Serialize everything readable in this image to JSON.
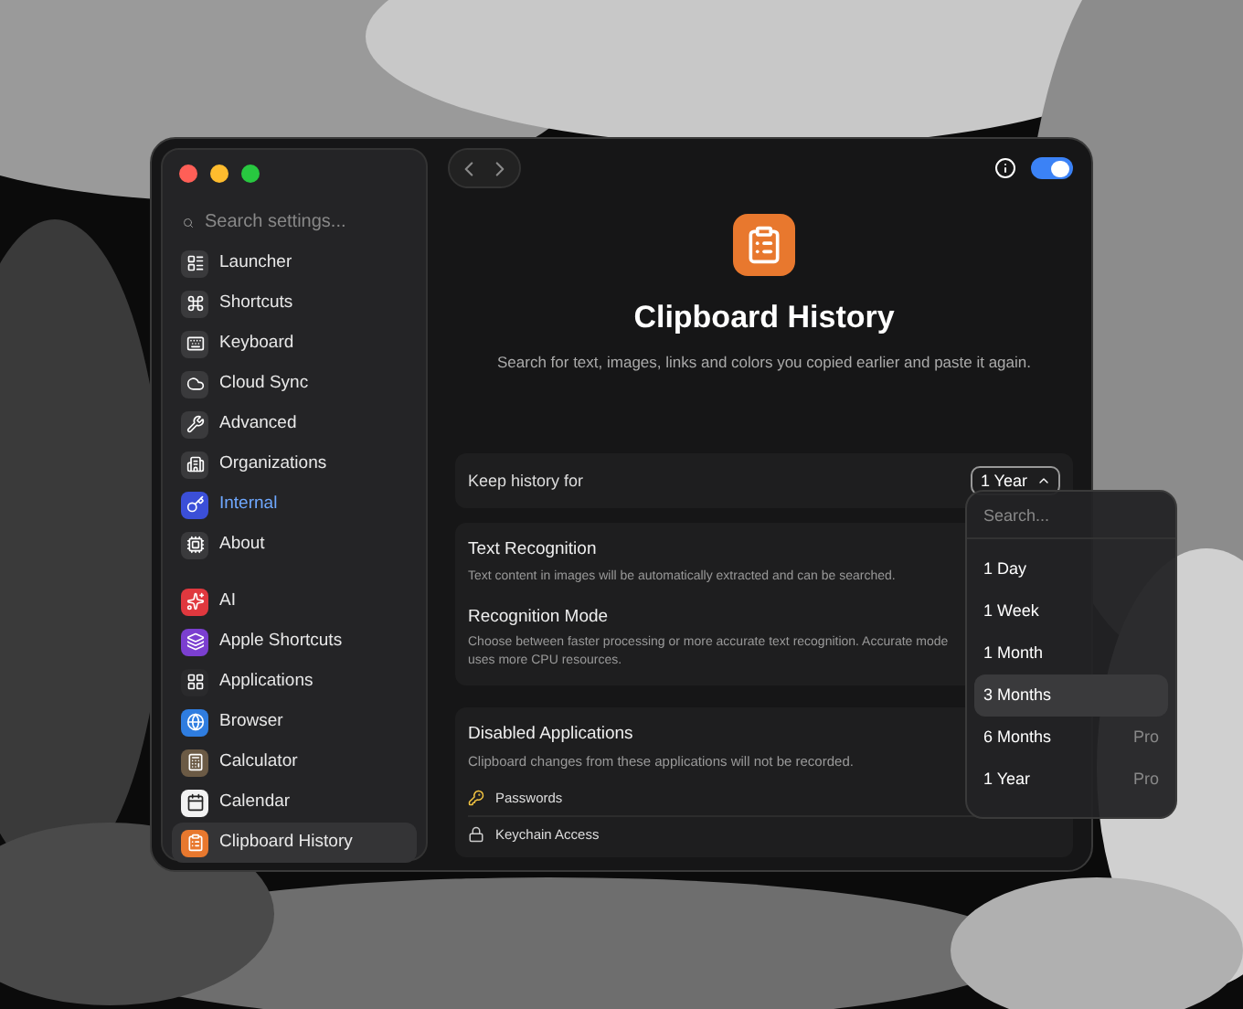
{
  "sidebar": {
    "search": {
      "placeholder": "Search settings..."
    },
    "groups": [
      [
        {
          "label": "Launcher",
          "color": "#3a3a3c",
          "selected": false,
          "kind": "normal"
        },
        {
          "label": "Shortcuts",
          "color": "#3a3a3c",
          "selected": false,
          "kind": "normal"
        },
        {
          "label": "Keyboard",
          "color": "#3a3a3c",
          "selected": false,
          "kind": "normal"
        },
        {
          "label": "Cloud Sync",
          "color": "#3a3a3c",
          "selected": false,
          "kind": "normal"
        },
        {
          "label": "Advanced",
          "color": "#3a3a3c",
          "selected": false,
          "kind": "normal"
        },
        {
          "label": "Organizations",
          "color": "#3a3a3c",
          "selected": false,
          "kind": "normal"
        },
        {
          "label": "Internal",
          "color": "#3b4fd8",
          "selected": false,
          "kind": "accent"
        },
        {
          "label": "About",
          "color": "#3a3a3c",
          "selected": false,
          "kind": "normal"
        }
      ],
      [
        {
          "label": "AI",
          "color": "#e0383e",
          "selected": false,
          "kind": "normal"
        },
        {
          "label": "Apple Shortcuts",
          "color": "#7b3fd0",
          "selected": false,
          "kind": "normal"
        },
        {
          "label": "Applications",
          "color": "#2a2a2c",
          "selected": false,
          "kind": "normal"
        },
        {
          "label": "Browser",
          "color": "#2f7de0",
          "selected": false,
          "kind": "normal"
        },
        {
          "label": "Calculator",
          "color": "#6b5a45",
          "selected": false,
          "kind": "normal"
        },
        {
          "label": "Calendar",
          "color": "#f2f2f2",
          "selected": false,
          "kind": "normal"
        },
        {
          "label": "Clipboard History",
          "color": "#e8782e",
          "selected": true,
          "kind": "normal"
        }
      ]
    ]
  },
  "header": {
    "enabled": true,
    "title": "Clipboard History",
    "description": "Search for text, images, links and colors you copied earlier and paste it again."
  },
  "keep_history": {
    "label": "Keep history for",
    "value": "1 Year"
  },
  "recognition": [
    {
      "title": "Text Recognition",
      "description": "Text content in images will be automatically extracted and can be searched."
    },
    {
      "title": "Recognition Mode",
      "description": "Choose between faster processing or more accurate text recognition. Accurate mode uses more CPU resources."
    }
  ],
  "disabled_applications": {
    "title": "Disabled Applications",
    "description": "Clipboard changes from these applications will not be recorded.",
    "apps": [
      "Passwords",
      "Keychain Access"
    ]
  },
  "dropdown": {
    "search": {
      "placeholder": "Search..."
    },
    "options": [
      {
        "label": "1 Day",
        "selected": false
      },
      {
        "label": "1 Week",
        "selected": false
      },
      {
        "label": "1 Month",
        "selected": false
      },
      {
        "label": "3 Months",
        "selected": true
      },
      {
        "label": "6 Months",
        "selected": false,
        "badge": "Pro"
      },
      {
        "label": "1 Year",
        "selected": false,
        "badge": "Pro"
      }
    ]
  }
}
